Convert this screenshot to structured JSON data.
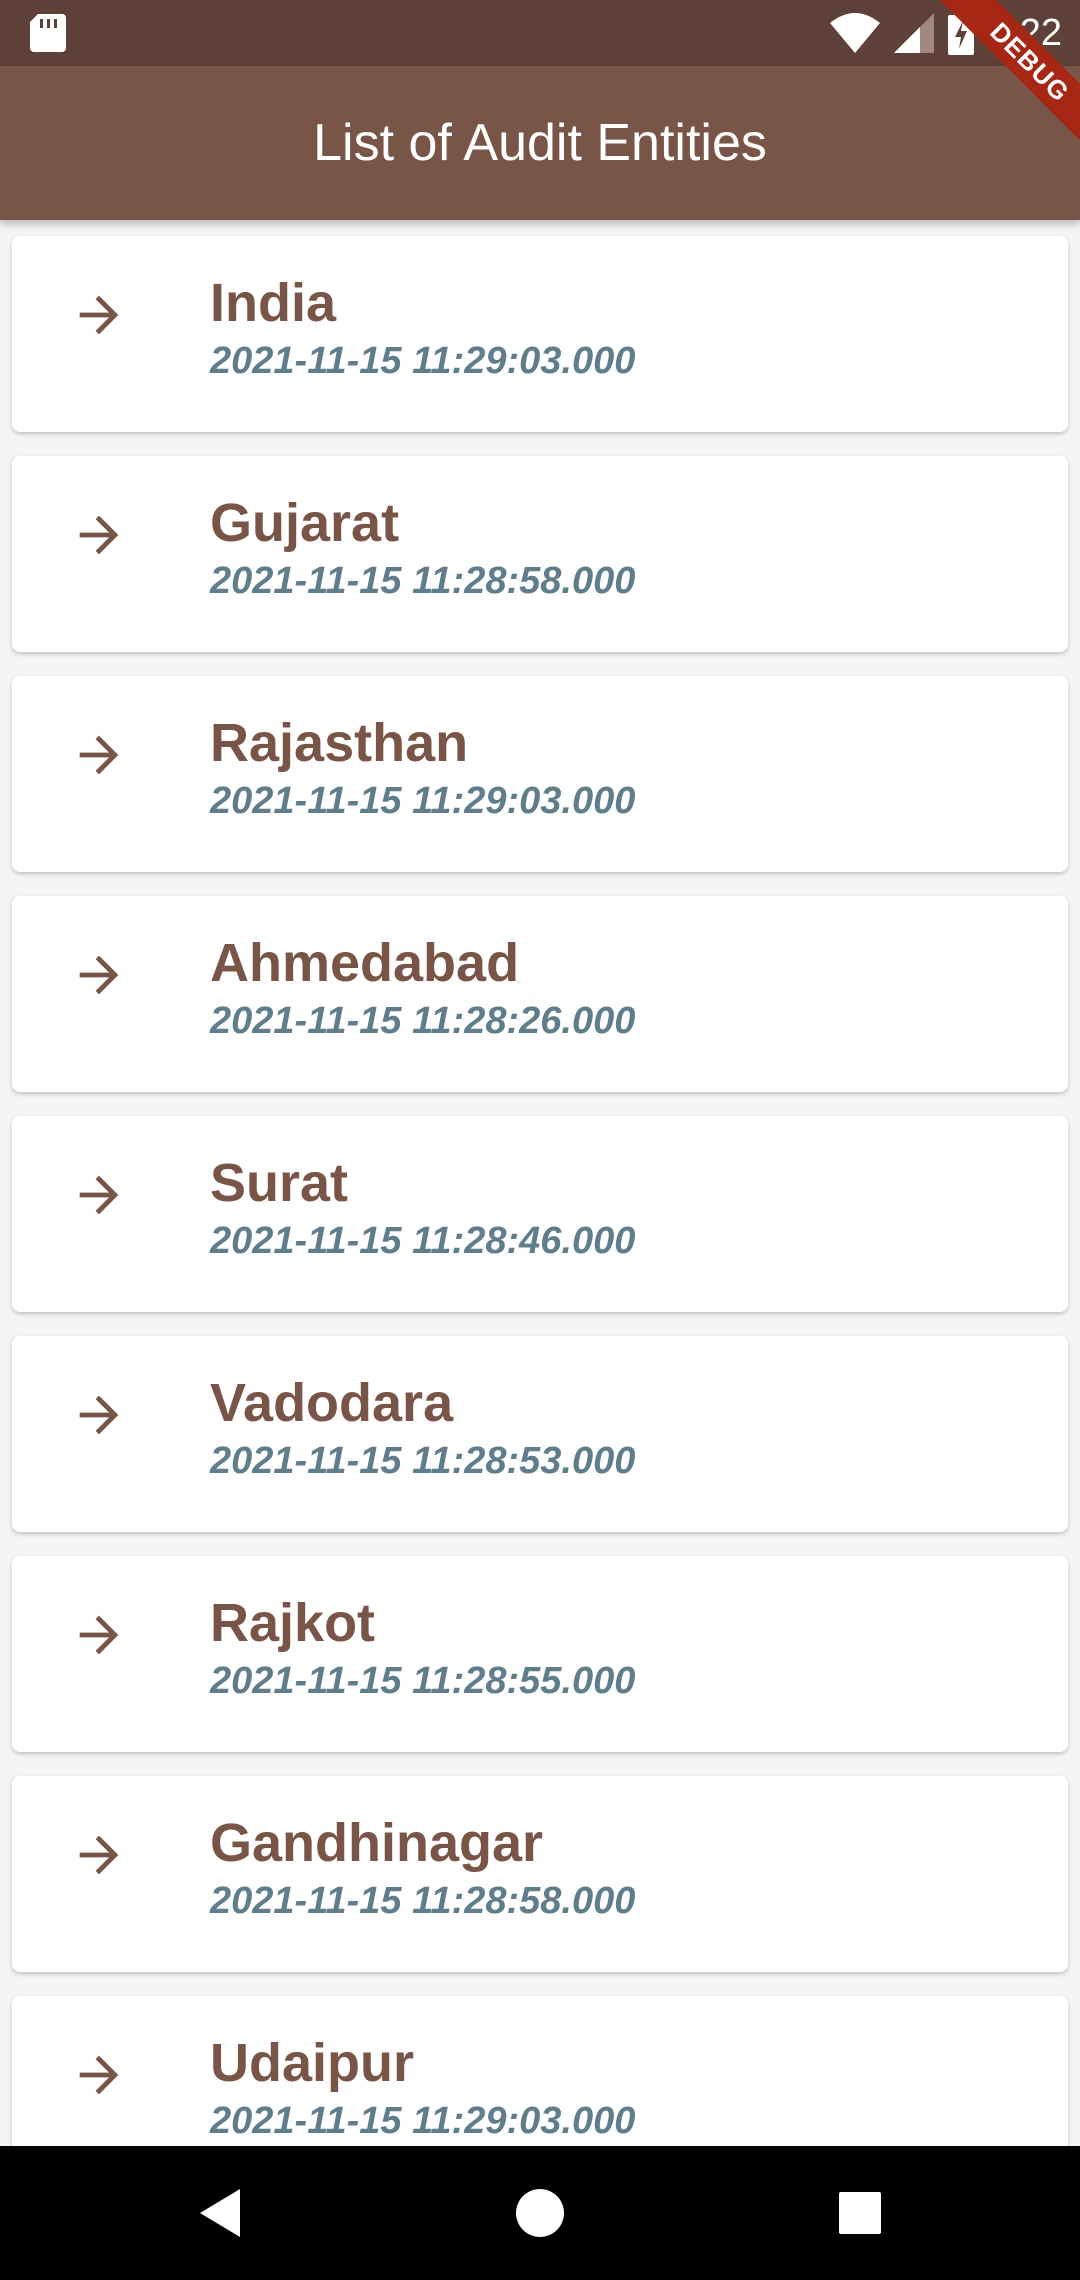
{
  "status_bar": {
    "time": "5:22",
    "icons": [
      "sd-card-icon",
      "wifi-icon",
      "signal-icon",
      "battery-charging-icon"
    ]
  },
  "app_bar": {
    "title": "List of Audit Entities"
  },
  "debug_banner": {
    "label": "DEBUG"
  },
  "entities": [
    {
      "name": "India",
      "timestamp": "2021-11-15 11:29:03.000"
    },
    {
      "name": "Gujarat",
      "timestamp": "2021-11-15 11:28:58.000"
    },
    {
      "name": "Rajasthan",
      "timestamp": "2021-11-15 11:29:03.000"
    },
    {
      "name": "Ahmedabad",
      "timestamp": "2021-11-15 11:28:26.000"
    },
    {
      "name": "Surat",
      "timestamp": "2021-11-15 11:28:46.000"
    },
    {
      "name": "Vadodara",
      "timestamp": "2021-11-15 11:28:53.000"
    },
    {
      "name": "Rajkot",
      "timestamp": "2021-11-15 11:28:55.000"
    },
    {
      "name": "Gandhinagar",
      "timestamp": "2021-11-15 11:28:58.000"
    },
    {
      "name": "Udaipur",
      "timestamp": "2021-11-15 11:29:03.000"
    }
  ],
  "colors": {
    "status_bar": "#5d4037",
    "app_bar": "#795548",
    "entity_name": "#795548",
    "timestamp": "#607d8b",
    "debug_banner": "#a52714"
  },
  "nav_bar": {
    "buttons": [
      "back-icon",
      "home-icon",
      "recents-icon"
    ]
  }
}
